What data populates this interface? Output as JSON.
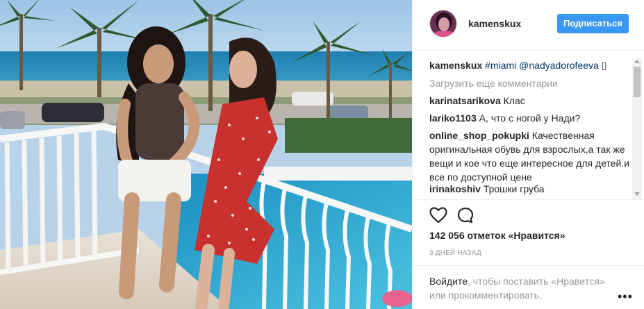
{
  "post": {
    "username": "kamenskux",
    "follow_label": "Подписаться",
    "caption": {
      "user": "kamenskux",
      "text": "#miami @nadyadorofeeva",
      "emoji": "▯"
    },
    "load_more_label": "Загрузить еще комментарии",
    "comments": [
      {
        "user": "karinatsarikova",
        "text": "Клас"
      },
      {
        "user": "lariko1103",
        "text": "А, что с ногой у Нади?"
      },
      {
        "user": "online_shop_pokupki",
        "text": "Качественная оригинальная обувь для взрослых,а так же вещи и кое что еще интересное для детей.и все по доступной цене"
      },
      {
        "user": "irinakoshiv",
        "text": "Трошки груба"
      }
    ],
    "likes": "142 056 отметок «Нравится»",
    "time": "3 ДНЕЙ НАЗАД",
    "login_prompt": {
      "link": "Войдите",
      "text": ", чтобы поставить «Нравится» или прокомментировать."
    },
    "more_label": "•••"
  },
  "icons": {
    "like": "heart-icon",
    "comment": "comment-icon",
    "more": "more-options-icon"
  },
  "colors": {
    "accent": "#3897f0",
    "muted": "#999999",
    "text": "#262626",
    "border": "#efefef"
  }
}
